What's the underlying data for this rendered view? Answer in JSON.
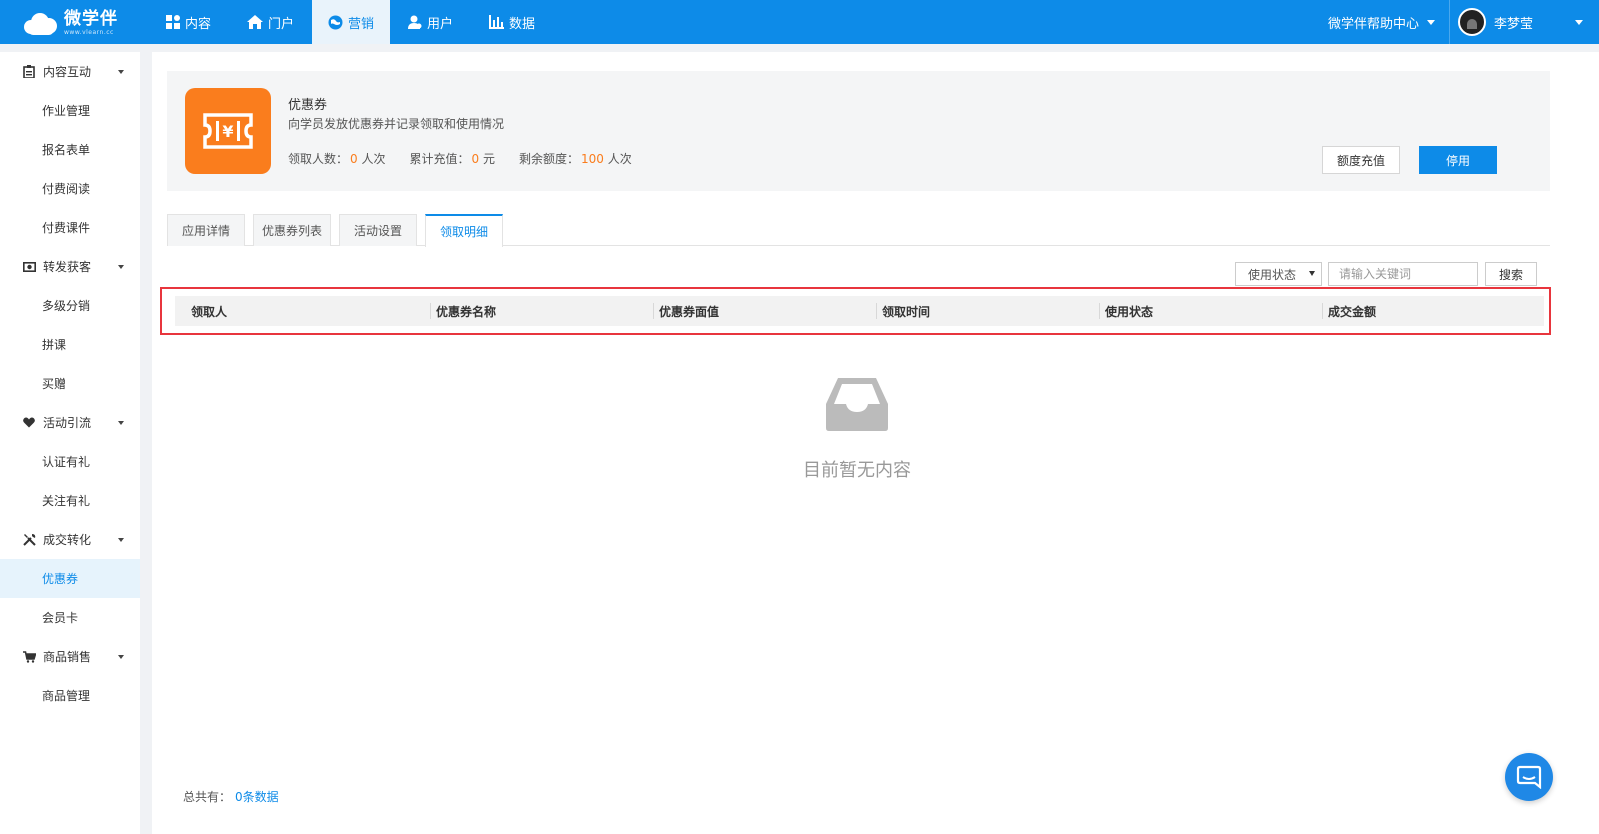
{
  "brand": {
    "name": "微学伴",
    "url": "www.vlearn.cc"
  },
  "topnav": [
    {
      "label": "内容",
      "icon": "content-grid-icon"
    },
    {
      "label": "门户",
      "icon": "home-icon"
    },
    {
      "label": "营销",
      "icon": "marketing-globe-icon",
      "active": true
    },
    {
      "label": "用户",
      "icon": "user-icon"
    },
    {
      "label": "数据",
      "icon": "bar-chart-icon"
    }
  ],
  "header": {
    "help_label": "微学伴帮助中心",
    "user_name": "李梦莹"
  },
  "sidebar": {
    "groups": [
      {
        "label": "内容互动",
        "icon": "clipboard-icon",
        "items": [
          "作业管理",
          "报名表单",
          "付费阅读",
          "付费课件"
        ]
      },
      {
        "label": "转发获客",
        "icon": "share-camera-icon",
        "items": [
          "多级分销",
          "拼课",
          "买赠"
        ]
      },
      {
        "label": "活动引流",
        "icon": "heart-icon",
        "items": [
          "认证有礼",
          "关注有礼"
        ]
      },
      {
        "label": "成交转化",
        "icon": "tools-icon",
        "items": [
          "优惠券",
          "会员卡"
        ]
      },
      {
        "label": "商品销售",
        "icon": "cart-icon",
        "items": [
          "商品管理"
        ]
      }
    ],
    "active_item": "优惠券"
  },
  "app": {
    "title": "优惠券",
    "desc": "向学员发放优惠券并记录领取和使用情况",
    "stats": [
      {
        "label": "领取人数：",
        "value": "0",
        "unit": "人次"
      },
      {
        "label": "累计充值：",
        "value": "0",
        "unit": "元"
      },
      {
        "label": "剩余额度：",
        "value": "100",
        "unit": "人次"
      }
    ],
    "recharge_label": "额度充值",
    "disable_label": "停用",
    "accent": "#fa7d1d"
  },
  "tabs": [
    "应用详情",
    "优惠券列表",
    "活动设置",
    "领取明细"
  ],
  "active_tab": "领取明细",
  "filter": {
    "status_label": "使用状态",
    "search_placeholder": "请输入关键词",
    "search_button": "搜索"
  },
  "table": {
    "columns": [
      "领取人",
      "优惠券名称",
      "优惠券面值",
      "领取时间",
      "使用状态",
      "成交金额"
    ]
  },
  "empty_text": "目前暂无内容",
  "footer": {
    "total_label": "总共有：",
    "total_value": "0条数据"
  },
  "colors": {
    "primary": "#0d8be8",
    "highlight": "#e8353d"
  }
}
